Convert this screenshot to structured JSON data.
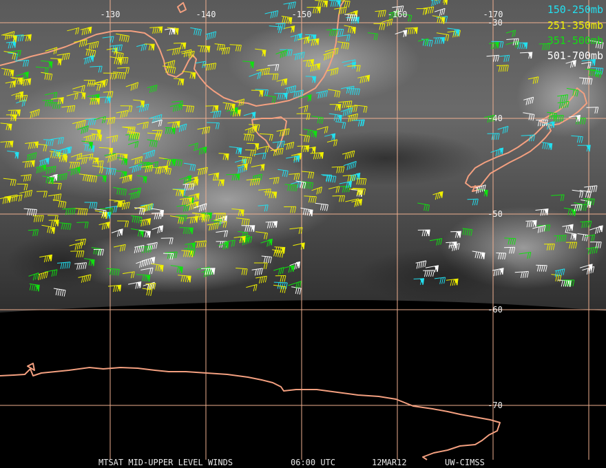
{
  "map": {
    "longitude_labels": [
      "-130",
      "-140",
      "-150",
      "-160",
      "-170"
    ],
    "latitude_labels": [
      "-30",
      "-40",
      "-50",
      "-60",
      "-70"
    ]
  },
  "legend": [
    {
      "label": "150-250mb",
      "color": "#22e0f0"
    },
    {
      "label": "251-350mb",
      "color": "#f0f000"
    },
    {
      "label": "351-500mb",
      "color": "#10e010"
    },
    {
      "label": "501-700mb",
      "color": "#ffffff"
    }
  ],
  "footer": {
    "product": "MTSAT MID-UPPER LEVEL WINDS",
    "time": "06:00 UTC",
    "date": "12MAR12",
    "source": "UW-CIMSS"
  },
  "colors": {
    "coastline": "#f4a080",
    "grid": "#f0b090",
    "background": "#000000"
  }
}
